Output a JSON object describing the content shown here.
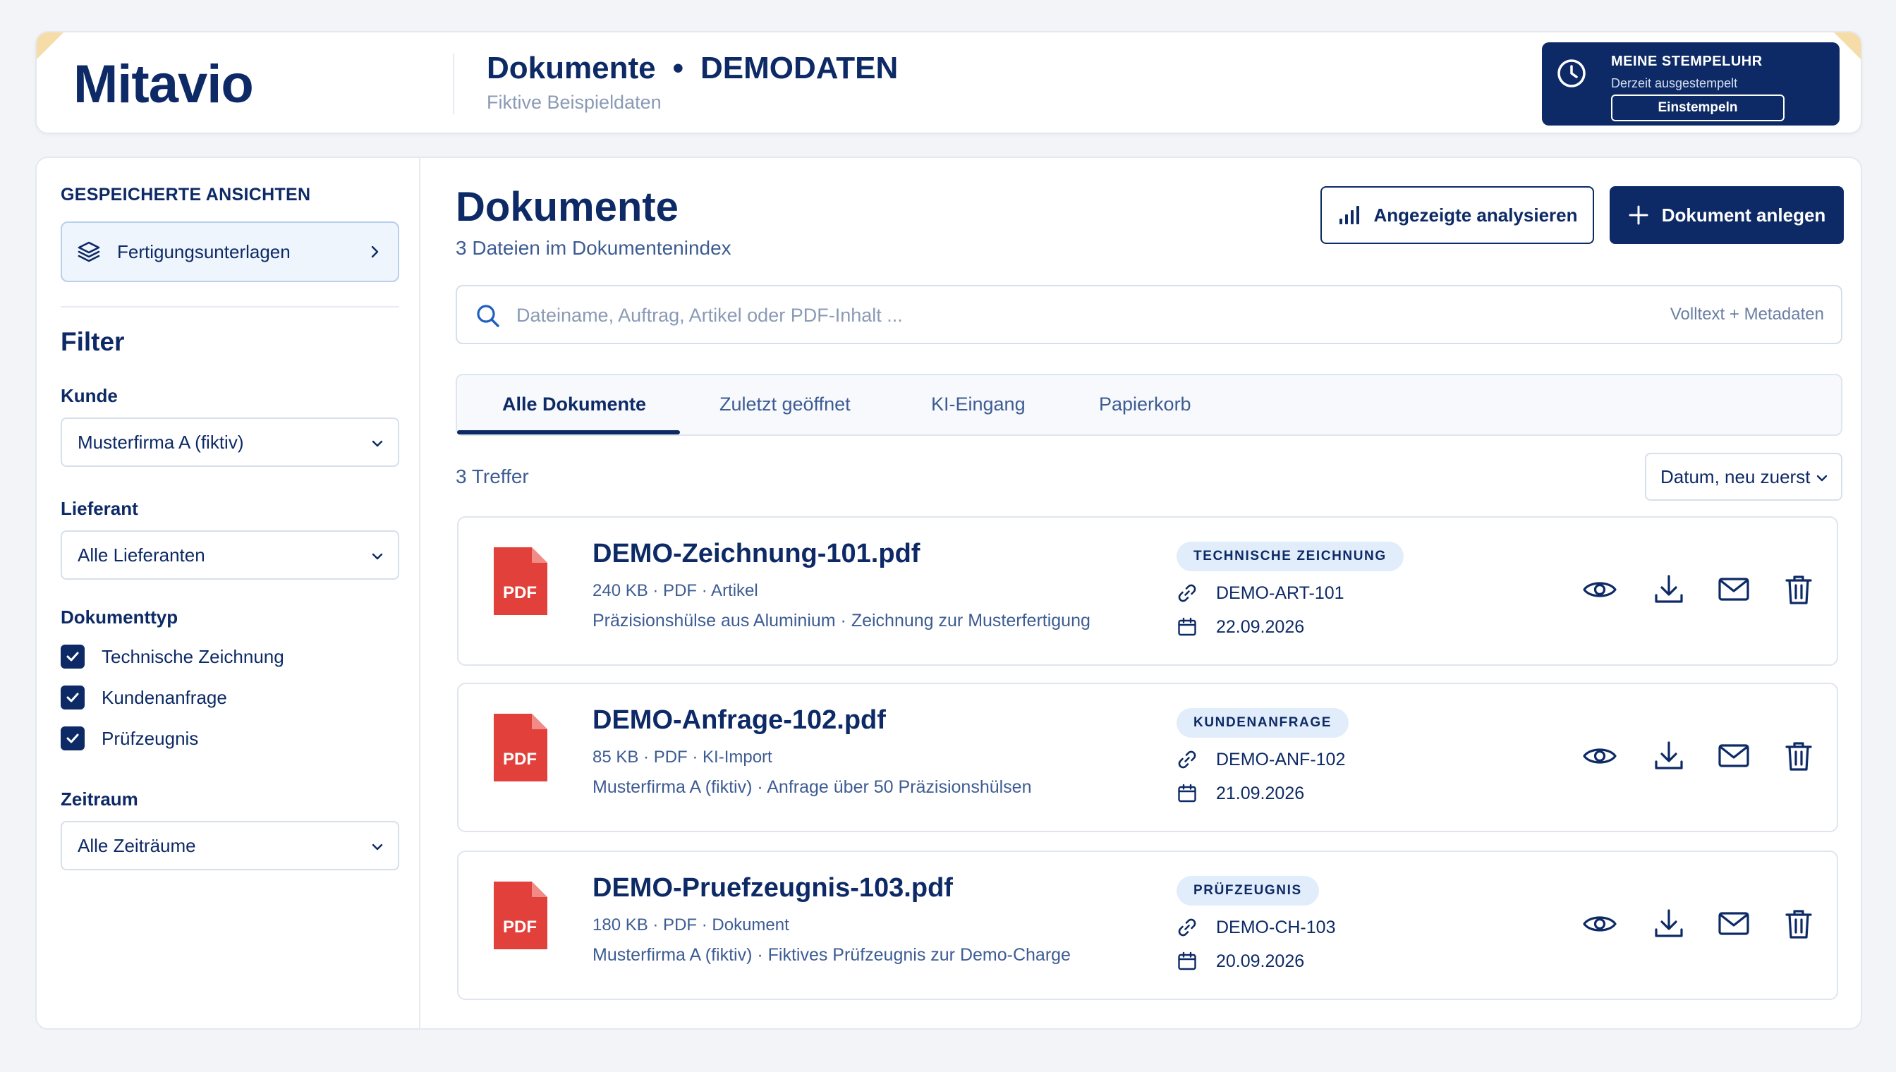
{
  "header": {
    "logo": "Mitavio",
    "title": "Dokumente",
    "title_separator": "•",
    "title_tag": "DEMODATEN",
    "subtitle": "Fiktive Beispieldaten",
    "clock": {
      "title": "MEINE STEMPELUHR",
      "status": "Derzeit ausgestempelt",
      "button": "Einstempeln"
    }
  },
  "sidebar": {
    "saved_views_title": "GESPEICHERTE ANSICHTEN",
    "saved_view": "Fertigungsunterlagen",
    "filter_title": "Filter",
    "kunde_label": "Kunde",
    "kunde_value": "Musterfirma A (fiktiv)",
    "lieferant_label": "Lieferant",
    "lieferant_value": "Alle Lieferanten",
    "dokumenttyp_label": "Dokumenttyp",
    "dokumenttypen": [
      "Technische Zeichnung",
      "Kundenanfrage",
      "Prüfzeugnis"
    ],
    "zeitraum_label": "Zeitraum",
    "zeitraum_value": "Alle Zeiträume"
  },
  "content": {
    "title": "Dokumente",
    "subtitle": "3 Dateien im Dokumentenindex",
    "analyze_button": "Angezeigte analysieren",
    "create_button": "Dokument anlegen",
    "search_placeholder": "Dateiname, Auftrag, Artikel oder PDF-Inhalt ...",
    "search_hint": "Volltext + Metadaten",
    "tabs": [
      "Alle Dokumente",
      "Zuletzt geöffnet",
      "KI-Eingang",
      "Papierkorb"
    ],
    "hits": "3 Treffer",
    "sort": "Datum, neu zuerst",
    "pdf_label": "PDF",
    "documents": [
      {
        "name": "DEMO-Zeichnung-101.pdf",
        "meta": "240 KB · PDF · Artikel",
        "desc": "Präzisionshülse aus Aluminium · Zeichnung zur Musterfertigung",
        "badge": "TECHNISCHE ZEICHNUNG",
        "ref": "DEMO-ART-101",
        "date": "22.09.2026"
      },
      {
        "name": "DEMO-Anfrage-102.pdf",
        "meta": "85 KB · PDF · KI-Import",
        "desc": "Musterfirma A (fiktiv) · Anfrage über 50 Präzisionshülsen",
        "badge": "KUNDENANFRAGE",
        "ref": "DEMO-ANF-102",
        "date": "21.09.2026"
      },
      {
        "name": "DEMO-Pruefzeugnis-103.pdf",
        "meta": "180 KB · PDF · Dokument",
        "desc": "Musterfirma A (fiktiv) · Fiktives Prüfzeugnis zur Demo-Charge",
        "badge": "PRÜFZEUGNIS",
        "ref": "DEMO-CH-103",
        "date": "20.09.2026"
      }
    ]
  },
  "colors": {
    "navy": "#0d2a66",
    "pdf_red": "#e2403a",
    "badge_bg": "#e2edfb",
    "accent_corner": "#f6dca6"
  },
  "icons": [
    "clock-icon",
    "layers-icon",
    "chevron-right-icon",
    "chevron-down-icon",
    "check-icon",
    "bar-chart-icon",
    "plus-icon",
    "search-icon",
    "pdf-file-icon",
    "link-icon",
    "calendar-icon",
    "eye-icon",
    "download-icon",
    "mail-icon",
    "trash-icon"
  ]
}
